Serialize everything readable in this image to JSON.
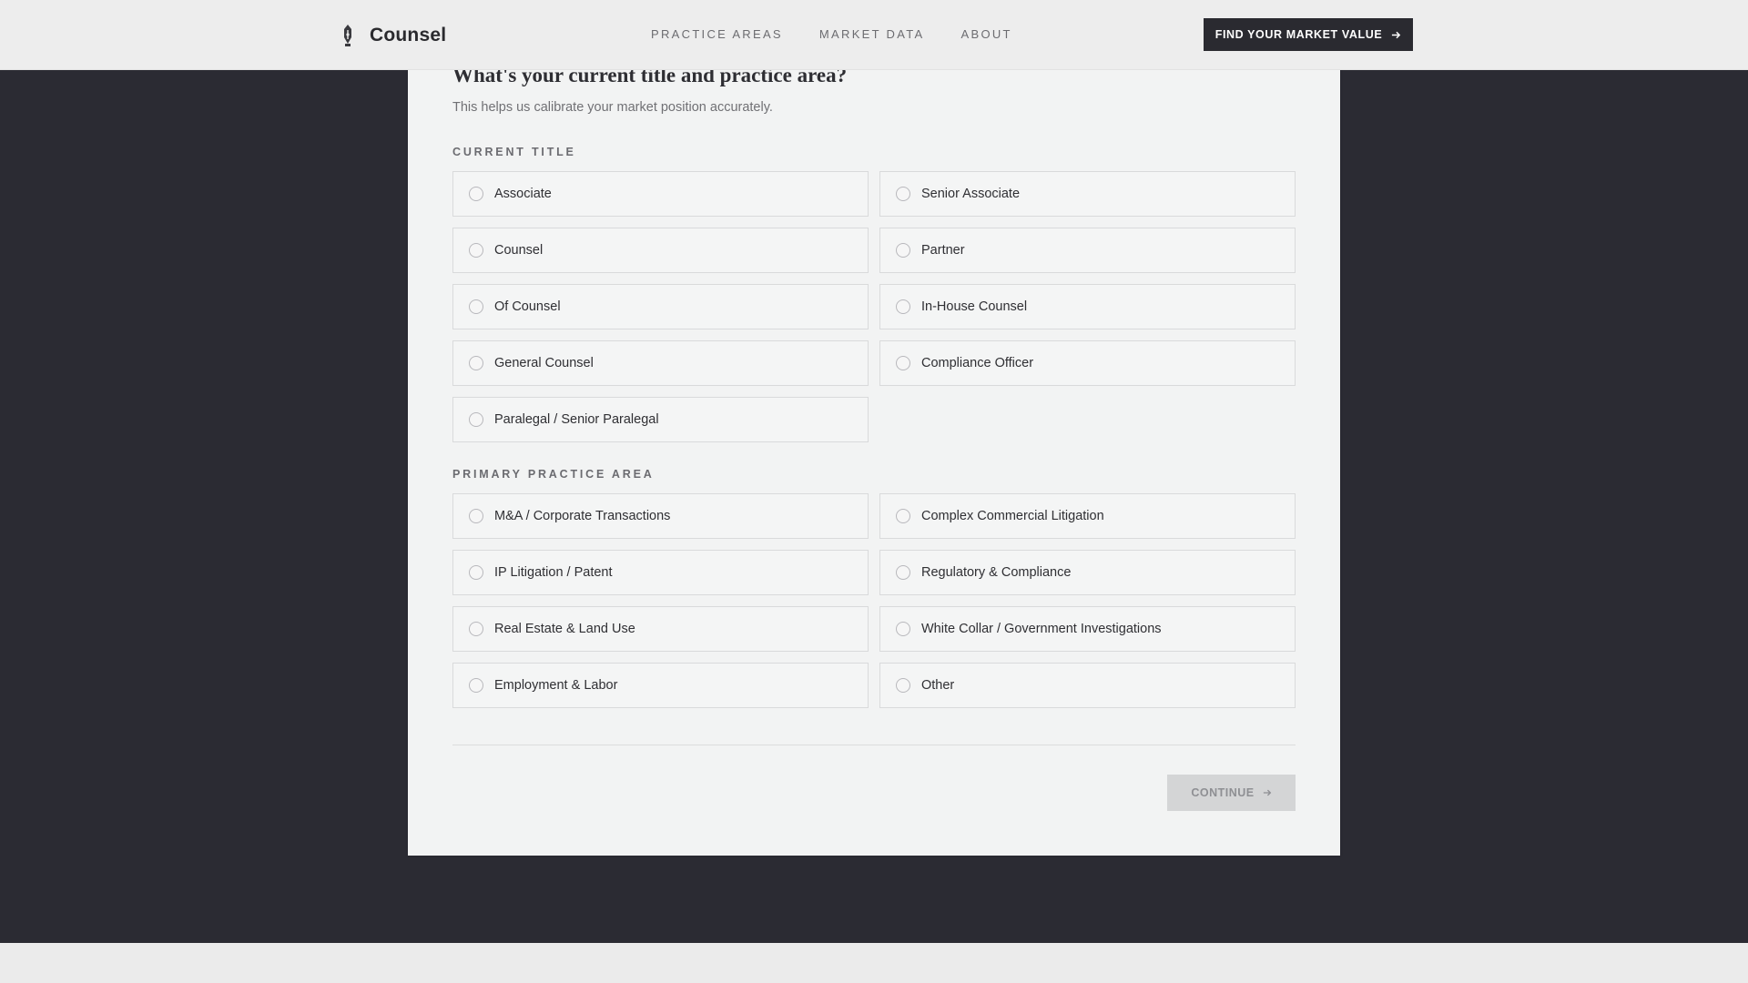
{
  "header": {
    "brand_name": "Counsel",
    "brand_icon": "pen-nib-icon",
    "nav": [
      {
        "label": "PRACTICE AREAS"
      },
      {
        "label": "MARKET DATA"
      },
      {
        "label": "ABOUT"
      }
    ],
    "cta_label": "FIND YOUR MARKET VALUE",
    "cta_icon": "arrow-right-icon"
  },
  "form": {
    "question": "What's your current title and practice area?",
    "subtitle": "This helps us calibrate your market position accurately.",
    "title_section": {
      "label": "CURRENT TITLE",
      "options": [
        "Associate",
        "Senior Associate",
        "Counsel",
        "Partner",
        "Of Counsel",
        "In-House Counsel",
        "General Counsel",
        "Compliance Officer",
        "Paralegal / Senior Paralegal"
      ]
    },
    "practice_section": {
      "label": "PRIMARY PRACTICE AREA",
      "options": [
        "M&A / Corporate Transactions",
        "Complex Commercial Litigation",
        "IP Litigation / Patent",
        "Regulatory & Compliance",
        "Real Estate & Land Use",
        "White Collar / Government Investigations",
        "Employment & Labor",
        "Other"
      ]
    },
    "continue_label": "CONTINUE",
    "continue_enabled": false
  },
  "colors": {
    "page_bg": "#2b2b33",
    "header_bg": "#ededed",
    "cta_bg": "#2a2a30",
    "card_bg": "#f2f3f3",
    "continue_disabled_bg": "#d4d5d6"
  }
}
